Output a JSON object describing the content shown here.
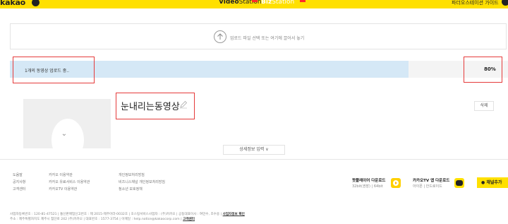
{
  "header": {
    "logo": "kakao",
    "nav_video": "Video",
    "nav_video_suffix": "Station",
    "nav_biz": "Biz",
    "nav_biz_suffix": "Station",
    "guide": "파더오스테이션 가이드"
  },
  "upload": {
    "dropzone_text": "업로드 파일 선택 또는 여기에 끌어서 놓기",
    "progress_label": "1개의 동영상 업로드 중..",
    "progress_percent": "80%",
    "progress_value": 0.8
  },
  "video": {
    "title": "눈내리는동영상",
    "delete_label": "삭제",
    "details_label": "상세정보 입력 ∨",
    "thumb_face": "ᵕ"
  },
  "footer": {
    "col1": [
      "도움말",
      "공지사항",
      "고객센터"
    ],
    "col2": [
      "카카오 이용약관",
      "카카오 유료서비스 이용약관",
      "카카오TV 이용약관"
    ],
    "col3": [
      "개인정보처리방침",
      "비즈니스채널 개인정보처리방침",
      "청소년 보호정책"
    ],
    "potplayer_title": "팟플레이어 다운로드",
    "potplayer_sub": "32bit(권장) | 64bit",
    "kakaotv_title": "카카오TV 앱 다운로드",
    "kakaotv_sub": "아이폰 | 안드로이드",
    "channel_add": "채널추가",
    "biz_info_1": "사업자등록번호 : 120-81-47521 | 통신판매업신고번호 : 제 2015-제주아라-0032호 | 호스팅서비스사업자 : (주)카카오 | 공동대표이사 : 여민수, 조수용 |",
    "biz_info_link": "사업자정보 확인",
    "biz_info_2": "주소 : 제주특별자치도 제주시 첨단로 242 (주)카카오 | 대표번호 : 1577-3754 | 이메일 : help.notice@kakaocorp.com |",
    "biz_info_2_link": "고객센터"
  },
  "colors": {
    "brand_yellow": "#ffe000",
    "progress_fill": "#d5e8f6",
    "annotation_red": "#e53b3b"
  }
}
